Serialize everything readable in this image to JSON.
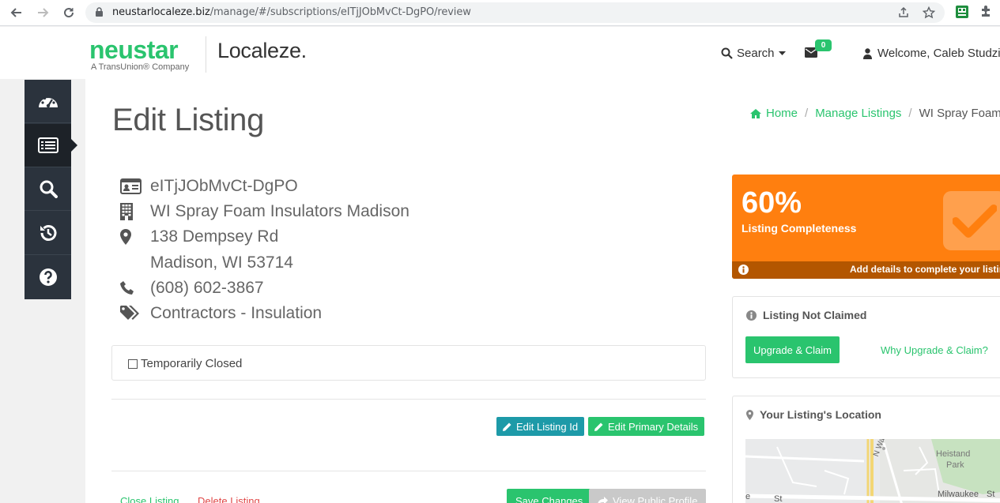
{
  "browser": {
    "url_domain": "neustarlocaleze.biz",
    "url_path": "/manage/#/subscriptions/eITjJObMvCt-DgPO/review"
  },
  "header": {
    "logo_brand": "neustar",
    "logo_sub": "A TransUnion® Company",
    "logo_product": "Localeze.",
    "search_label": "Search",
    "mail_count": "0",
    "welcome": "Welcome, Caleb Studzi"
  },
  "sidebar": {
    "items": [
      {
        "icon": "dashboard-icon"
      },
      {
        "icon": "list-icon"
      },
      {
        "icon": "search-icon"
      },
      {
        "icon": "history-icon"
      },
      {
        "icon": "help-icon"
      }
    ],
    "active_index": 1
  },
  "page": {
    "title": "Edit Listing",
    "breadcrumb": {
      "home": "Home",
      "manage": "Manage Listings",
      "current": "WI Spray Foam"
    }
  },
  "listing": {
    "id": "eITjJObMvCt-DgPO",
    "name": "WI Spray Foam Insulators Madison",
    "address1": "138 Dempsey Rd",
    "address2": "Madison, WI 53714",
    "phone": "(608) 602-3867",
    "category": "Contractors - Insulation"
  },
  "closed": {
    "label": "Temporarily Closed",
    "checked": false
  },
  "actions": {
    "edit_id": "Edit Listing Id",
    "edit_primary": "Edit Primary Details",
    "close_listing": "Close Listing",
    "delete_listing": "Delete Listing",
    "save_changes": "Save Changes",
    "view_public": "View Public Profile"
  },
  "completeness": {
    "percent": "60%",
    "label": "Listing Completeness",
    "footer": "Add details to complete your listing"
  },
  "claim": {
    "title": "Listing Not Claimed",
    "upgrade_button": "Upgrade & Claim",
    "why_link": "Why Upgrade & Claim?"
  },
  "location": {
    "title": "Your Listing's Location",
    "map_labels": {
      "park": "Heistand",
      "park2": "Park",
      "street1": "Milwaukee",
      "street2": "St",
      "road": "N Walbridge",
      "corner": "e",
      "corner2": "St"
    }
  },
  "colors": {
    "brand_green": "#2ac46e",
    "orange": "#ff7f0f",
    "teal": "#1d9aa8",
    "sidebar": "#2b333d"
  }
}
